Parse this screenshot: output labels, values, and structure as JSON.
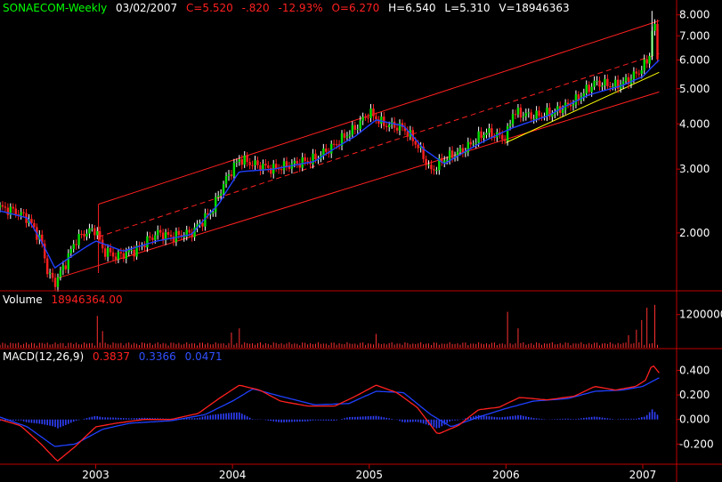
{
  "header": {
    "symbol": "SONAECOM-Weekly",
    "date": "03/02/2007",
    "close": "C=5.520",
    "change": "-.820",
    "change_pct": "-12.93%",
    "open": "O=6.270",
    "high": "H=6.540",
    "low": "L=5.310",
    "volume": "V=18946363"
  },
  "volume_panel": {
    "label": "Volume",
    "value": "18946364.00"
  },
  "macd_panel": {
    "label": "MACD(12,26,9)",
    "macd": "0.3837",
    "signal": "0.3366",
    "histogram": "0.0471"
  },
  "colors": {
    "up": "#00e000",
    "down": "#ff2020",
    "channel": "#ff2020",
    "trendline": "#ffff00",
    "ma": "#2040ff",
    "volume": "#ff3030",
    "macd": "#ff2020",
    "signal": "#2040ff",
    "hist": "#3040ff",
    "symbol": "#00ff00",
    "text": "#ffffff",
    "axis": "#c00000"
  },
  "chart_data": [
    {
      "type": "candlestick",
      "scale": "log",
      "ylim": [
        1.4,
        8.4
      ],
      "price_ticks": [
        "8.000",
        "7.000",
        "6.000",
        "5.000",
        "4.000",
        "3.000",
        "2.000"
      ],
      "price_tick_values": [
        8,
        7,
        6,
        5,
        4,
        3,
        2
      ],
      "x_ticks": [
        "2003",
        "2004",
        "2005",
        "2006",
        "2007"
      ],
      "x_tick_values": [
        2003,
        2004,
        2005,
        2006,
        2007
      ],
      "xlim": [
        2002.3,
        2007.15
      ],
      "anchors": [
        [
          2002.3,
          2.35
        ],
        [
          2002.4,
          2.3
        ],
        [
          2002.5,
          2.2
        ],
        [
          2002.6,
          1.9
        ],
        [
          2002.65,
          1.55
        ],
        [
          2002.7,
          1.45
        ],
        [
          2002.78,
          1.65
        ],
        [
          2002.85,
          1.9
        ],
        [
          2002.92,
          2.0
        ],
        [
          2003.0,
          2.05
        ],
        [
          2003.05,
          1.8
        ],
        [
          2003.15,
          1.72
        ],
        [
          2003.3,
          1.8
        ],
        [
          2003.45,
          2.0
        ],
        [
          2003.55,
          1.95
        ],
        [
          2003.7,
          2.0
        ],
        [
          2003.85,
          2.3
        ],
        [
          2003.95,
          2.8
        ],
        [
          2004.05,
          3.2
        ],
        [
          2004.15,
          3.1
        ],
        [
          2004.3,
          3.0
        ],
        [
          2004.45,
          3.1
        ],
        [
          2004.6,
          3.2
        ],
        [
          2004.75,
          3.5
        ],
        [
          2004.9,
          3.9
        ],
        [
          2005.0,
          4.3
        ],
        [
          2005.1,
          4.0
        ],
        [
          2005.25,
          3.9
        ],
        [
          2005.35,
          3.5
        ],
        [
          2005.45,
          2.95
        ],
        [
          2005.55,
          3.2
        ],
        [
          2005.7,
          3.4
        ],
        [
          2005.85,
          3.8
        ],
        [
          2006.0,
          3.65
        ],
        [
          2006.05,
          4.3
        ],
        [
          2006.2,
          4.2
        ],
        [
          2006.35,
          4.3
        ],
        [
          2006.5,
          4.6
        ],
        [
          2006.65,
          5.2
        ],
        [
          2006.8,
          5.1
        ],
        [
          2006.9,
          5.3
        ],
        [
          2007.0,
          5.7
        ],
        [
          2007.05,
          6.2
        ],
        [
          2007.08,
          7.8
        ],
        [
          2007.12,
          5.52
        ]
      ],
      "ma_anchors": [
        [
          2002.3,
          2.3
        ],
        [
          2002.5,
          2.2
        ],
        [
          2002.7,
          1.6
        ],
        [
          2002.85,
          1.75
        ],
        [
          2003.0,
          1.9
        ],
        [
          2003.2,
          1.78
        ],
        [
          2003.45,
          1.9
        ],
        [
          2003.7,
          1.98
        ],
        [
          2003.9,
          2.4
        ],
        [
          2004.05,
          2.95
        ],
        [
          2004.3,
          3.0
        ],
        [
          2004.6,
          3.15
        ],
        [
          2004.9,
          3.7
        ],
        [
          2005.05,
          4.1
        ],
        [
          2005.25,
          3.95
        ],
        [
          2005.4,
          3.4
        ],
        [
          2005.55,
          3.1
        ],
        [
          2005.85,
          3.6
        ],
        [
          2006.05,
          3.9
        ],
        [
          2006.3,
          4.2
        ],
        [
          2006.6,
          4.8
        ],
        [
          2006.85,
          5.1
        ],
        [
          2007.0,
          5.4
        ],
        [
          2007.12,
          6.0
        ]
      ],
      "channel": {
        "upper": [
          [
            2003.02,
            2.4
          ],
          [
            2007.12,
            7.7
          ]
        ],
        "mid": [
          [
            2003.02,
            1.95
          ],
          [
            2007.12,
            6.25
          ]
        ],
        "lower": [
          [
            2002.72,
            1.5
          ],
          [
            2007.12,
            4.9
          ]
        ],
        "left_edge": [
          [
            2003.02,
            1.55
          ],
          [
            2003.02,
            2.4
          ]
        ]
      },
      "trendline": [
        [
          2006.0,
          3.55
        ],
        [
          2007.12,
          5.55
        ]
      ]
    },
    {
      "type": "bar",
      "name": "Volume",
      "ylim": [
        0,
        1800000
      ],
      "tick_labels": [
        "1200000"
      ],
      "tick_values": [
        1200000
      ],
      "spikes": [
        [
          2003.02,
          1150000
        ],
        [
          2003.05,
          600000
        ],
        [
          2004.0,
          550000
        ],
        [
          2004.05,
          700000
        ],
        [
          2005.05,
          500000
        ],
        [
          2006.02,
          1300000
        ],
        [
          2006.08,
          700000
        ],
        [
          2006.9,
          450000
        ],
        [
          2006.96,
          650000
        ],
        [
          2007.0,
          1000000
        ],
        [
          2007.04,
          1450000
        ],
        [
          2007.08,
          1550000
        ],
        [
          2007.12,
          1400000
        ]
      ]
    },
    {
      "type": "line",
      "name": "MACD(12,26,9)",
      "ylim": [
        -0.35,
        0.52
      ],
      "tick_labels": [
        "0.400",
        "0.200",
        "0.000",
        "-0.200"
      ],
      "tick_values": [
        0.4,
        0.2,
        0.0,
        -0.2
      ],
      "macd_anchors": [
        [
          2002.3,
          0.0
        ],
        [
          2002.45,
          -0.05
        ],
        [
          2002.6,
          -0.2
        ],
        [
          2002.72,
          -0.34
        ],
        [
          2002.85,
          -0.22
        ],
        [
          2003.0,
          -0.06
        ],
        [
          2003.15,
          -0.03
        ],
        [
          2003.35,
          0.0
        ],
        [
          2003.55,
          0.0
        ],
        [
          2003.75,
          0.05
        ],
        [
          2003.9,
          0.17
        ],
        [
          2004.05,
          0.28
        ],
        [
          2004.2,
          0.24
        ],
        [
          2004.35,
          0.15
        ],
        [
          2004.55,
          0.11
        ],
        [
          2004.75,
          0.11
        ],
        [
          2004.9,
          0.19
        ],
        [
          2005.05,
          0.28
        ],
        [
          2005.2,
          0.22
        ],
        [
          2005.35,
          0.1
        ],
        [
          2005.5,
          -0.12
        ],
        [
          2005.65,
          -0.05
        ],
        [
          2005.8,
          0.08
        ],
        [
          2005.95,
          0.1
        ],
        [
          2006.1,
          0.18
        ],
        [
          2006.3,
          0.16
        ],
        [
          2006.5,
          0.19
        ],
        [
          2006.65,
          0.27
        ],
        [
          2006.8,
          0.24
        ],
        [
          2006.95,
          0.27
        ],
        [
          2007.02,
          0.32
        ],
        [
          2007.07,
          0.45
        ],
        [
          2007.12,
          0.38
        ]
      ],
      "signal_anchors": [
        [
          2002.3,
          0.02
        ],
        [
          2002.5,
          -0.06
        ],
        [
          2002.7,
          -0.22
        ],
        [
          2002.85,
          -0.2
        ],
        [
          2003.05,
          -0.08
        ],
        [
          2003.25,
          -0.03
        ],
        [
          2003.55,
          -0.01
        ],
        [
          2003.8,
          0.04
        ],
        [
          2004.0,
          0.15
        ],
        [
          2004.15,
          0.25
        ],
        [
          2004.35,
          0.19
        ],
        [
          2004.6,
          0.12
        ],
        [
          2004.85,
          0.13
        ],
        [
          2005.05,
          0.23
        ],
        [
          2005.25,
          0.22
        ],
        [
          2005.45,
          0.04
        ],
        [
          2005.6,
          -0.06
        ],
        [
          2005.8,
          0.02
        ],
        [
          2006.0,
          0.09
        ],
        [
          2006.2,
          0.15
        ],
        [
          2006.45,
          0.17
        ],
        [
          2006.65,
          0.23
        ],
        [
          2006.85,
          0.24
        ],
        [
          2007.0,
          0.27
        ],
        [
          2007.12,
          0.34
        ]
      ]
    }
  ]
}
